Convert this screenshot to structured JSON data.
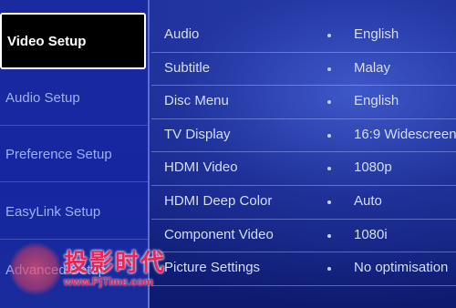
{
  "menu": {
    "items": [
      {
        "label": "Video Setup",
        "active": true
      },
      {
        "label": "Audio Setup",
        "active": false
      },
      {
        "label": "Preference Setup",
        "active": false
      },
      {
        "label": "EasyLink Setup",
        "active": false
      },
      {
        "label": "Advanced Setup",
        "active": false
      }
    ]
  },
  "settings": {
    "rows": [
      {
        "label": "Audio",
        "value": "English"
      },
      {
        "label": "Subtitle",
        "value": "Malay"
      },
      {
        "label": "Disc Menu",
        "value": "English"
      },
      {
        "label": "TV Display",
        "value": "16:9 Widescreen"
      },
      {
        "label": "HDMI Video",
        "value": "1080p"
      },
      {
        "label": "HDMI Deep Color",
        "value": "Auto"
      },
      {
        "label": "Component Video",
        "value": "1080i"
      },
      {
        "label": "Picture Settings",
        "value": "No optimisation"
      }
    ]
  },
  "watermark": {
    "chars": "投影时代",
    "url": "www.PjTime.com"
  },
  "colors": {
    "background": "#16258a",
    "active_item_bg": "#000000",
    "text": "#d6defb",
    "watermark": "#e8245a"
  }
}
